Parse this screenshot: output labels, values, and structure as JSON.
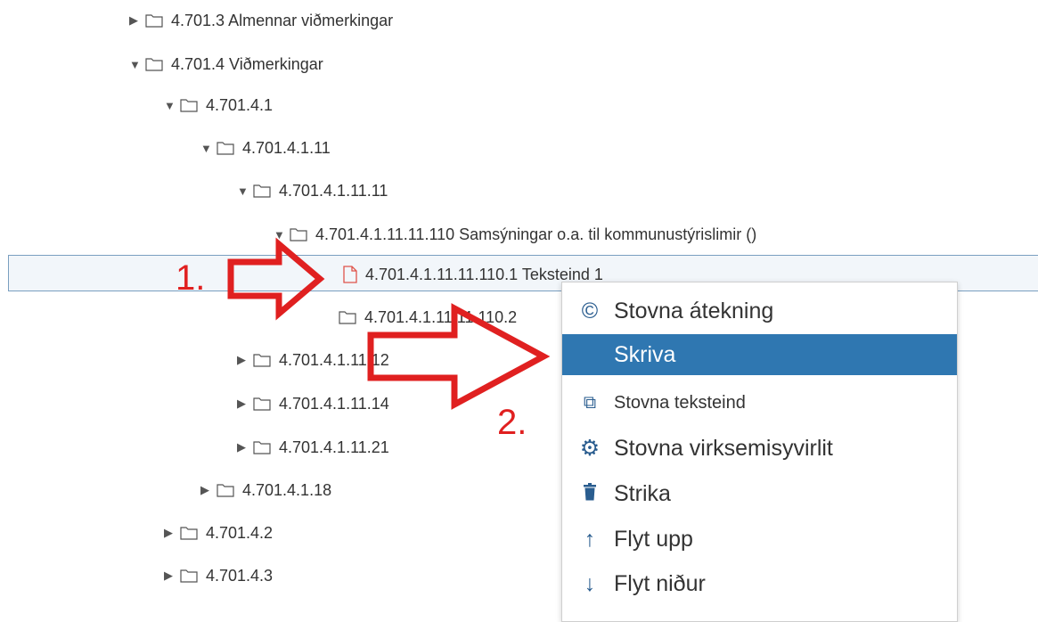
{
  "tree": {
    "rows": [
      {
        "label": "4.701.3 Almennar viðmerkingar",
        "expanded": false
      },
      {
        "label": "4.701.4 Viðmerkingar",
        "expanded": true
      },
      {
        "label": "4.701.4.1",
        "expanded": true
      },
      {
        "label": "4.701.4.1.11",
        "expanded": true
      },
      {
        "label": "4.701.4.1.11.11",
        "expanded": true
      },
      {
        "label": "4.701.4.1.11.11.110 Samsýningar o.a. til kommunustýrislimir ()",
        "expanded": true
      },
      {
        "label": "4.701.4.1.11.11.110.1 Teksteind 1",
        "type": "document",
        "selected": true
      },
      {
        "label": "4.701.4.1.11.11.110.2",
        "type": "folder"
      },
      {
        "label": "4.701.4.1.11.12",
        "expanded": false
      },
      {
        "label": "4.701.4.1.11.14",
        "expanded": false
      },
      {
        "label": "4.701.4.1.11.21",
        "expanded": false
      },
      {
        "label": "4.701.4.1.18",
        "expanded": false
      },
      {
        "label": "4.701.4.2",
        "expanded": false
      },
      {
        "label": "4.701.4.3",
        "expanded": false
      }
    ]
  },
  "context_menu": {
    "items": [
      {
        "label": "Stovna átekning",
        "icon": "copyright-icon"
      },
      {
        "label": "Skriva",
        "icon": "none",
        "highlighted": true
      },
      {
        "label": "Stovna teksteind",
        "icon": "copy-icon"
      },
      {
        "label": "Stovna virksemisyvirlit",
        "icon": "gear-icon"
      },
      {
        "label": "Strika",
        "icon": "trash-icon"
      },
      {
        "label": "Flyt upp",
        "icon": "arrow-up-icon"
      },
      {
        "label": "Flyt niður",
        "icon": "arrow-down-icon"
      }
    ]
  },
  "annotations": {
    "step1": "1.",
    "step2": "2."
  },
  "colors": {
    "annotation_red": "#e02020",
    "menu_highlight": "#2f77b1",
    "document_icon": "#e0544a"
  }
}
